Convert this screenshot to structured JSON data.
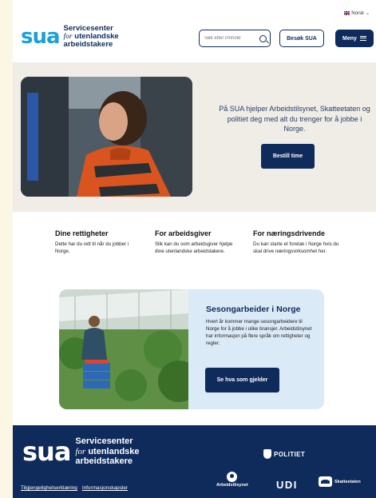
{
  "header": {
    "language": "Norsk",
    "logo_mark": "sua",
    "logo_line1": "Servicesenter",
    "logo_line2_italic": "for",
    "logo_line2": "utenlandske",
    "logo_line3": "arbeidstakere",
    "search_placeholder": "Søk etter innhold",
    "visit_button": "Besøk SUA",
    "menu_button": "Meny"
  },
  "hero": {
    "text": "På SUA hjelper Arbeidstilsynet, Skatteetaten og politiet deg med alt du trenger for å jobbe i Norge.",
    "button": "Bestill time"
  },
  "features": [
    {
      "title": "Dine rettigheter",
      "text": "Dette har du rett til når du jobber i Norge."
    },
    {
      "title": "For arbeidsgiver",
      "text": "Slik kan du som arbeidsgiver hjelpe dine utenlandske arbeidstakere."
    },
    {
      "title": "For næringsdrivende",
      "text": "Du kan starte et foretak i Norge hvis du skal drive næringsvirksomhet her."
    }
  ],
  "seasonal": {
    "title": "Sesongarbeider i Norge",
    "text": "Hvert år kommer mange sesongarbeidere til Norge for å jobbe i ulike bransjer. Arbeidstilsynet har informasjon på flere språk om rettigheter og regler.",
    "button": "Se hva som gjelder"
  },
  "footer": {
    "logo_mark": "sua",
    "logo_line1": "Servicesenter",
    "logo_line2_italic": "for",
    "logo_line2": "utenlandske",
    "logo_line3": "arbeidstakere",
    "links": [
      "Tilgjengelighetserklæring",
      "Informasjonskapsler"
    ],
    "partners": {
      "politiet": "POLITIET",
      "arbeidstilsynet": "Arbeidstilsynet",
      "udi": "UDI",
      "skatteetaten": "Skatteetaten"
    }
  },
  "colors": {
    "brand_navy": "#0f2b5b",
    "brand_blue": "#1ba1d8",
    "hero_bg": "#efede6",
    "card_bg": "#dbeaf7"
  }
}
